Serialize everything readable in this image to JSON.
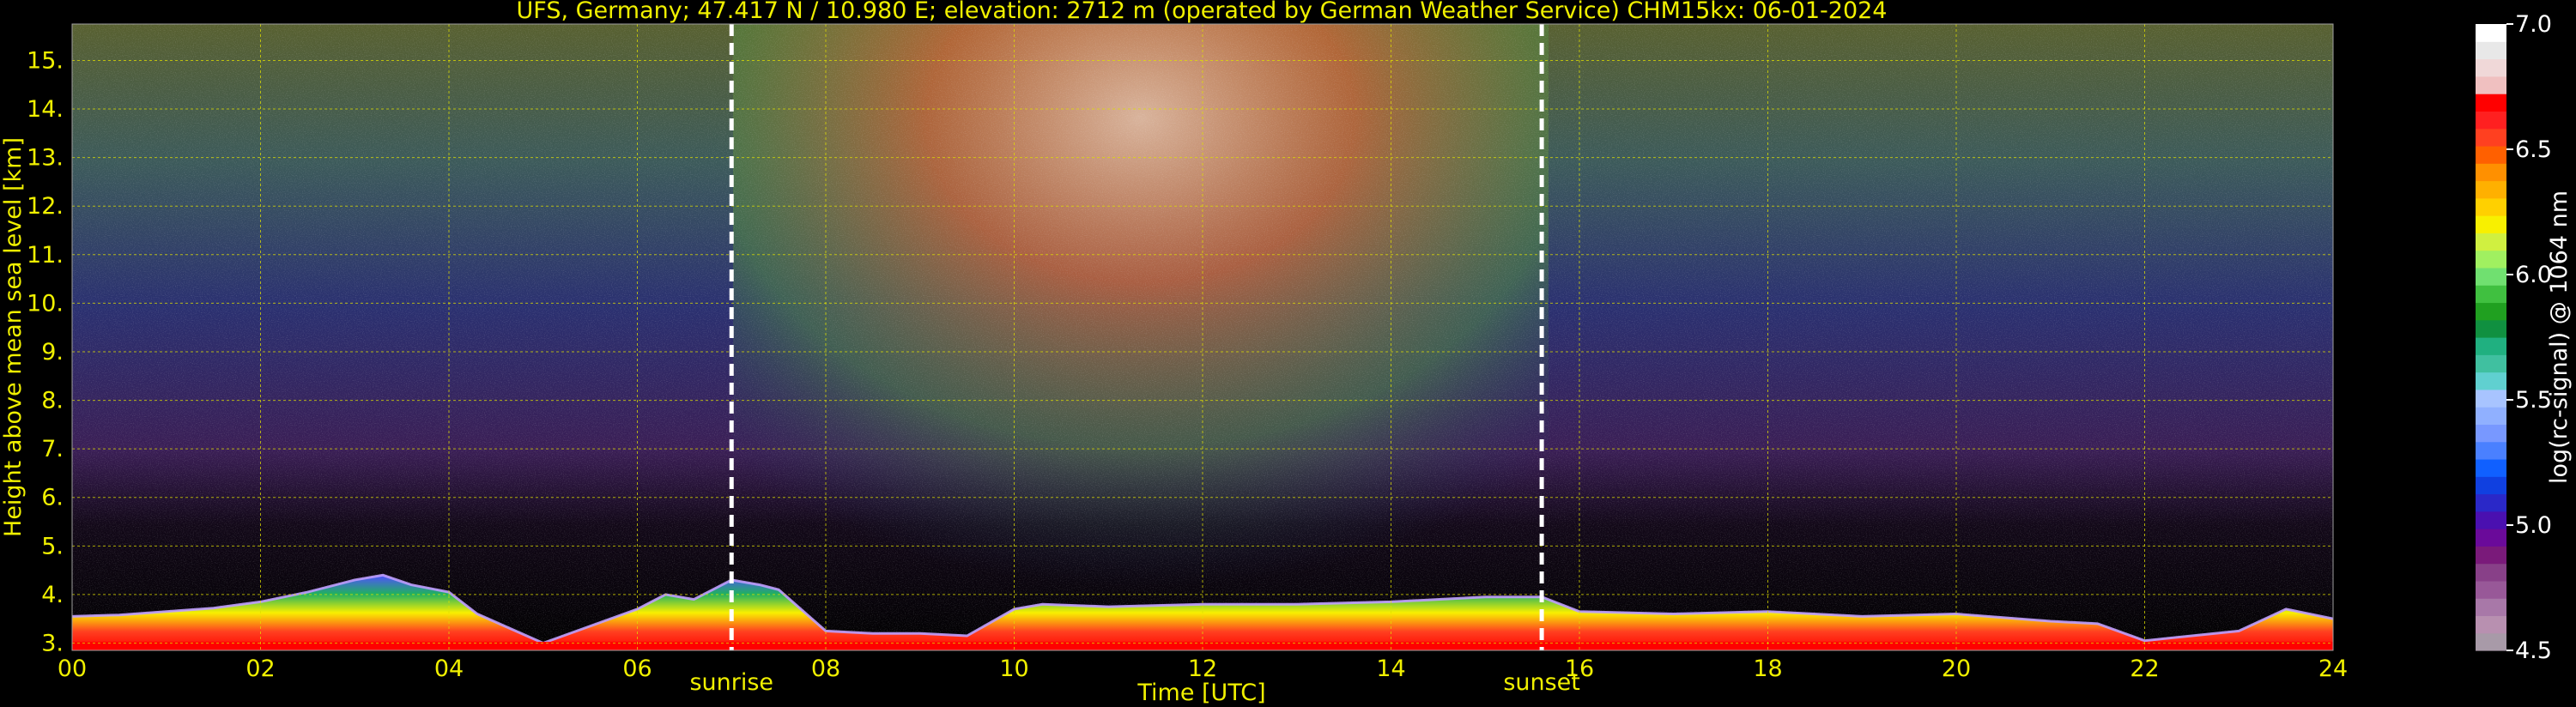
{
  "chart_data": {
    "type": "heatmap",
    "title": "UFS, Germany; 47.417 N / 10.980 E; elevation: 2712 m  (operated by German Weather Service)    CHM15kx: 06-01-2024",
    "xlabel": "Time [UTC]",
    "ylabel": "Height above mean sea level [km]",
    "xlim": [
      0,
      24
    ],
    "ylim": [
      2.85,
      15.75
    ],
    "x_ticks": [
      "00",
      "02",
      "04",
      "06",
      "08",
      "10",
      "12",
      "14",
      "16",
      "18",
      "20",
      "22",
      "24"
    ],
    "y_ticks": [
      "3.",
      "4.",
      "5.",
      "6.",
      "7.",
      "8.",
      "9.",
      "10.",
      "11.",
      "12.",
      "13.",
      "14.",
      "15."
    ],
    "grid": true,
    "annotations": [
      {
        "text": "sunrise",
        "x": 7.0
      },
      {
        "text": "sunset",
        "x": 15.6
      }
    ],
    "colorbar": {
      "label": "log(rc-signal) @ 1064 nm",
      "range": [
        4.5,
        7.0
      ],
      "ticks": [
        "4.5",
        "5.0",
        "5.5",
        "6.0",
        "6.5",
        "7.0"
      ],
      "colors": [
        "#a89aa8",
        "#b890b0",
        "#a878a8",
        "#985898",
        "#884088",
        "#7a1a7a",
        "#6a0a9a",
        "#4a10b0",
        "#2a28c8",
        "#1040e0",
        "#1060ff",
        "#4a80ff",
        "#7898ff",
        "#90b0ff",
        "#a8c4ff",
        "#60d0d0",
        "#40c0a0",
        "#20b080",
        "#109040",
        "#20a020",
        "#40c040",
        "#70e070",
        "#a0f060",
        "#d0f040",
        "#f8f000",
        "#ffd000",
        "#ffb000",
        "#ff9000",
        "#ff6000",
        "#ff4020",
        "#ff2020",
        "#ff0000",
        "#f0c0c0",
        "#f0d8d8",
        "#e8e8e8",
        "#ffffff"
      ]
    },
    "series": [
      {
        "name": "",
        "x": [
          0,
          0.5,
          1,
          1.5,
          2,
          2.5,
          3,
          3.3,
          3.6,
          4,
          4.3,
          5,
          6,
          6.3,
          6.6,
          7,
          7.3,
          7.5,
          8,
          8.5,
          9,
          9.5,
          10,
          10.3,
          11,
          12,
          13,
          14,
          15,
          15.6,
          16,
          17,
          18,
          19,
          20,
          21,
          21.5,
          22,
          23,
          23.5,
          24
        ],
        "y": [
          3.55,
          3.58,
          3.65,
          3.72,
          3.85,
          4.05,
          4.3,
          4.4,
          4.2,
          4.05,
          3.6,
          3.0,
          3.7,
          4.0,
          3.9,
          4.3,
          4.2,
          4.1,
          3.25,
          3.2,
          3.2,
          3.15,
          3.7,
          3.8,
          3.75,
          3.8,
          3.8,
          3.85,
          3.95,
          3.95,
          3.65,
          3.6,
          3.65,
          3.55,
          3.6,
          3.45,
          3.4,
          3.05,
          3.25,
          3.7,
          3.5
        ]
      }
    ]
  }
}
